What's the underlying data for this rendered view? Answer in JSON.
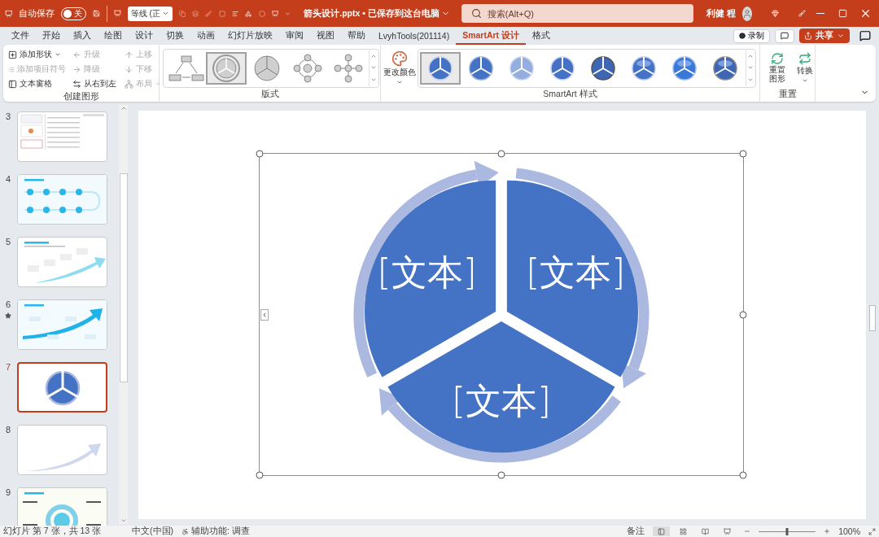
{
  "title_bar": {
    "autosave_label": "自动保存",
    "autosave_toggle": {
      "label": "关",
      "on": false
    },
    "font_box": "等线 (正",
    "file_title": "箭头设计.pptx • 已保存到这台电脑",
    "search": {
      "placeholder": "搜索(Alt+Q)"
    },
    "user_name": "利健 程"
  },
  "menu_tabs": [
    {
      "label": "文件",
      "selected": false
    },
    {
      "label": "开始",
      "selected": false
    },
    {
      "label": "插入",
      "selected": false
    },
    {
      "label": "绘图",
      "selected": false
    },
    {
      "label": "设计",
      "selected": false
    },
    {
      "label": "切换",
      "selected": false
    },
    {
      "label": "动画",
      "selected": false
    },
    {
      "label": "幻灯片放映",
      "selected": false
    },
    {
      "label": "审阅",
      "selected": false
    },
    {
      "label": "视图",
      "selected": false
    },
    {
      "label": "帮助",
      "selected": false
    },
    {
      "label": "LvyhTools(201114)",
      "selected": false
    },
    {
      "label": "SmartArt 设计",
      "selected": true
    },
    {
      "label": "格式",
      "selected": false
    }
  ],
  "header_actions": {
    "record": "录制",
    "share": "共享"
  },
  "ribbon": {
    "create_group": {
      "label": "创建图形",
      "commands": [
        {
          "label": "添加形状",
          "disabled": false,
          "dropdown": true
        },
        {
          "label": "添加项目符号",
          "disabled": true,
          "dropdown": false
        },
        {
          "label": "文本窗格",
          "disabled": false,
          "dropdown": false
        },
        {
          "label": "升级",
          "disabled": true,
          "dropdown": false
        },
        {
          "label": "降级",
          "disabled": true,
          "dropdown": false
        },
        {
          "label": "从右到左",
          "disabled": false,
          "dropdown": false
        },
        {
          "label": "上移",
          "disabled": true,
          "dropdown": false
        },
        {
          "label": "下移",
          "disabled": true,
          "dropdown": false
        },
        {
          "label": "布局",
          "disabled": true,
          "dropdown": true
        }
      ]
    },
    "layout_group": {
      "label": "版式",
      "layouts": [
        {
          "kind": "hierarchy",
          "selected": false
        },
        {
          "kind": "arrow-cycle",
          "selected": true
        },
        {
          "kind": "pie",
          "selected": false
        },
        {
          "kind": "ring",
          "selected": false
        },
        {
          "kind": "cross",
          "selected": false
        }
      ]
    },
    "style_group": {
      "label": "SmartArt 样式",
      "change_colors": "更改颜色",
      "styles": [
        {
          "kind": "flat",
          "selected": true
        },
        {
          "kind": "outline",
          "selected": false
        },
        {
          "kind": "faded",
          "selected": false
        },
        {
          "kind": "flat",
          "selected": false
        },
        {
          "kind": "dark-rim",
          "selected": false
        },
        {
          "kind": "glossy",
          "selected": false
        },
        {
          "kind": "bright",
          "selected": false
        },
        {
          "kind": "metallic",
          "selected": false
        }
      ]
    },
    "reset_group": {
      "label": "重置",
      "reset": "重置图形",
      "convert": "转换"
    }
  },
  "slides": [
    {
      "number": "3",
      "kind": "table",
      "selected": false,
      "animated": false
    },
    {
      "number": "4",
      "kind": "steps",
      "selected": false,
      "animated": false
    },
    {
      "number": "5",
      "kind": "arrow-text",
      "selected": false,
      "animated": false
    },
    {
      "number": "6",
      "kind": "arrow-timeline",
      "selected": false,
      "animated": true
    },
    {
      "number": "7",
      "kind": "cycle",
      "selected": true,
      "animated": false
    },
    {
      "number": "8",
      "kind": "arrow",
      "selected": false,
      "animated": false
    },
    {
      "number": "9",
      "kind": "pdca",
      "selected": false,
      "animated": false
    }
  ],
  "slide": {
    "diagram": {
      "selected": true,
      "segments": [
        {
          "text": "[文本]"
        },
        {
          "text": "[文本]"
        },
        {
          "text": "[文本]"
        }
      ]
    }
  },
  "status_bar": {
    "slide_info": "幻灯片 第 7 张，共 13 张",
    "language": "中文(中国)",
    "accessibility": "辅助功能: 调查",
    "notes": "备注",
    "views": [
      {
        "kind": "normal",
        "selected": true
      },
      {
        "kind": "sorter",
        "selected": false
      },
      {
        "kind": "reading",
        "selected": false
      },
      {
        "kind": "show",
        "selected": false
      }
    ],
    "zoom": {
      "level": 0.5,
      "reading": "100%"
    }
  }
}
